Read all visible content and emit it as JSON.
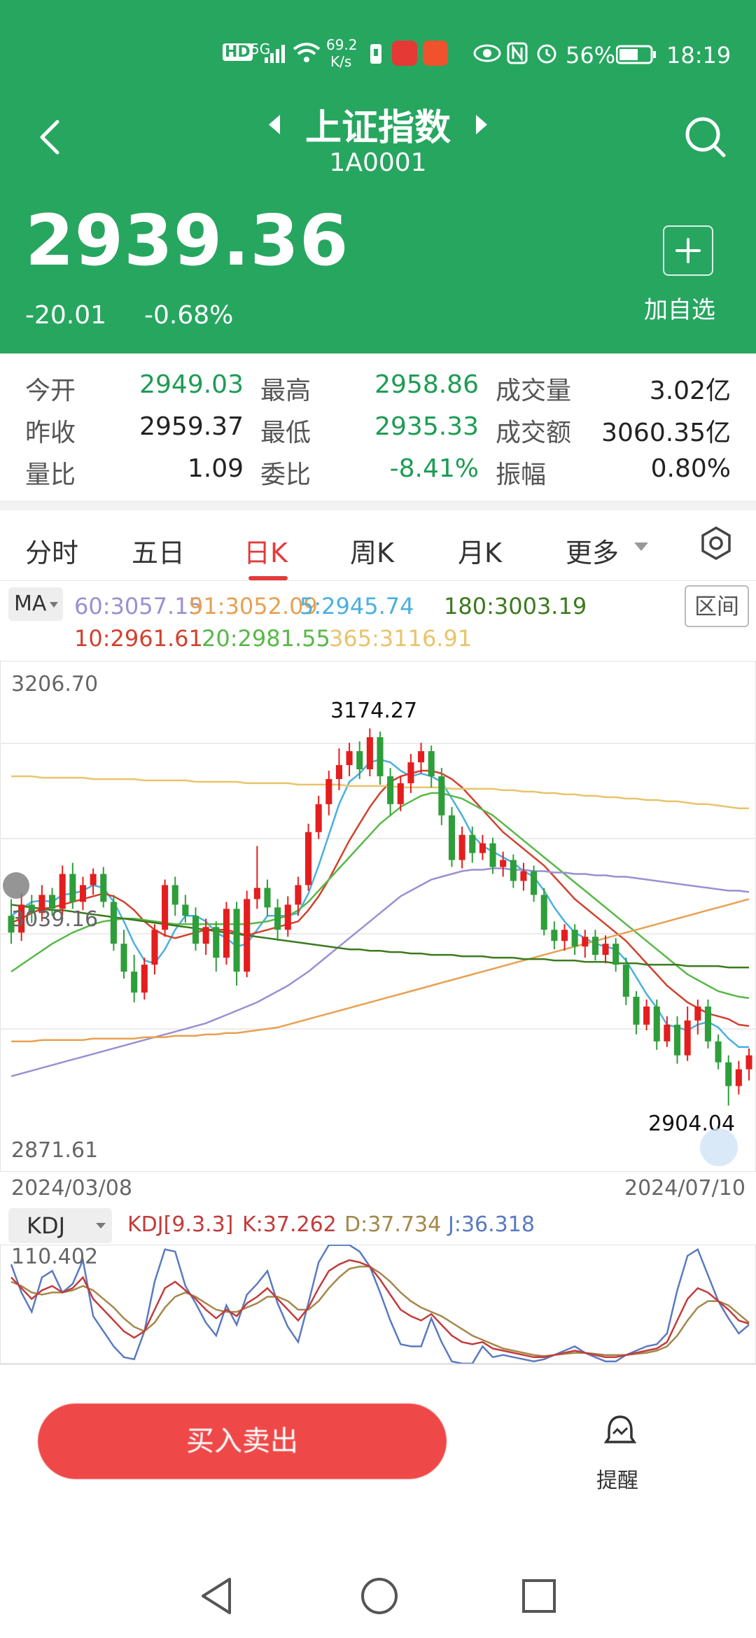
{
  "status_bar": {
    "hd": "HD",
    "signal": "5G",
    "speed_value": "69.2",
    "speed_unit": "K/s",
    "battery": "56%",
    "time": "18:19"
  },
  "header": {
    "title": "上证指数",
    "code": "1A0001",
    "price": "2939.36",
    "change": "-20.01",
    "change_pct": "-0.68%",
    "add_label": "加自选"
  },
  "stats": [
    {
      "label": "今开",
      "value": "2949.03",
      "color": "green"
    },
    {
      "label": "最高",
      "value": "2958.86",
      "color": "green"
    },
    {
      "label": "成交量",
      "value": "3.02亿",
      "color": "dark"
    },
    {
      "label": "昨收",
      "value": "2959.37",
      "color": "dark"
    },
    {
      "label": "最低",
      "value": "2935.33",
      "color": "green"
    },
    {
      "label": "成交额",
      "value": "3060.35亿",
      "color": "dark"
    },
    {
      "label": "量比",
      "value": "1.09",
      "color": "dark"
    },
    {
      "label": "委比",
      "value": "-8.41%",
      "color": "green"
    },
    {
      "label": "振幅",
      "value": "0.80%",
      "color": "dark"
    }
  ],
  "tabs": [
    {
      "label": "分时",
      "active": false
    },
    {
      "label": "五日",
      "active": false
    },
    {
      "label": "日K",
      "active": true
    },
    {
      "label": "周K",
      "active": false
    },
    {
      "label": "月K",
      "active": false
    },
    {
      "label": "更多",
      "active": false
    }
  ],
  "ma": {
    "button": "MA",
    "range_button": "区间",
    "items": [
      {
        "text": "60:3057.15",
        "color": "#9b8fd3"
      },
      {
        "text": "91:3052.09",
        "color": "#e8a050"
      },
      {
        "text": "5:2945.74",
        "color": "#4ab0e0"
      },
      {
        "text": "180:3003.19",
        "color": "#3c7a1e"
      },
      {
        "text": "10:2961.61",
        "color": "#d2412e"
      },
      {
        "text": "20:2981.55",
        "color": "#58b848"
      },
      {
        "text": "365:3116.91",
        "color": "#e8c46a"
      }
    ]
  },
  "chart": {
    "y_top": "3206.70",
    "y_mid": "3039.16",
    "y_bottom": "2871.61",
    "x_start": "2024/03/08",
    "x_end": "2024/07/10",
    "high_label": "3174.27",
    "low_label": "2904.04"
  },
  "kdj": {
    "button": "KDJ",
    "params": "KDJ[9.3.3]",
    "k": "K:37.262",
    "d": "D:37.734",
    "j": "J:36.318",
    "y_top": "110.402"
  },
  "bottom": {
    "big_button": "买入卖出",
    "remind": "提醒"
  },
  "chart_data": {
    "type": "candlestick",
    "title": "上证指数 日K",
    "x_range": [
      "2024/03/08",
      "2024/07/10"
    ],
    "ylim": [
      2871.61,
      3206.7
    ],
    "y_ticks": [
      2871.61,
      3039.16,
      3206.7
    ],
    "high": 3174.27,
    "low": 2904.04,
    "candles": [
      [
        3040,
        3028,
        3052,
        3020
      ],
      [
        3028,
        3048,
        3056,
        3022
      ],
      [
        3048,
        3042,
        3055,
        3035
      ],
      [
        3042,
        3055,
        3062,
        3036
      ],
      [
        3055,
        3045,
        3060,
        3040
      ],
      [
        3045,
        3070,
        3076,
        3040
      ],
      [
        3070,
        3050,
        3078,
        3045
      ],
      [
        3050,
        3062,
        3068,
        3044
      ],
      [
        3062,
        3070,
        3074,
        3055
      ],
      [
        3070,
        3050,
        3075,
        3046
      ],
      [
        3050,
        3020,
        3055,
        3015
      ],
      [
        3020,
        3000,
        3030,
        2995
      ],
      [
        3000,
        2985,
        3012,
        2978
      ],
      [
        2985,
        3005,
        3010,
        2980
      ],
      [
        3005,
        3030,
        3034,
        2998
      ],
      [
        3030,
        3062,
        3066,
        3025
      ],
      [
        3062,
        3048,
        3068,
        3040
      ],
      [
        3048,
        3040,
        3055,
        3035
      ],
      [
        3040,
        3020,
        3046,
        3015
      ],
      [
        3020,
        3032,
        3038,
        3012
      ],
      [
        3032,
        3010,
        3036,
        3000
      ],
      [
        3010,
        3045,
        3050,
        3005
      ],
      [
        3045,
        3000,
        3050,
        2990
      ],
      [
        3000,
        3052,
        3058,
        2996
      ],
      [
        3052,
        3060,
        3090,
        3045
      ],
      [
        3060,
        3046,
        3066,
        3040
      ],
      [
        3046,
        3030,
        3052,
        3022
      ],
      [
        3030,
        3048,
        3054,
        3025
      ],
      [
        3048,
        3062,
        3068,
        3040
      ],
      [
        3062,
        3100,
        3106,
        3058
      ],
      [
        3100,
        3120,
        3126,
        3095
      ],
      [
        3120,
        3138,
        3144,
        3112
      ],
      [
        3138,
        3148,
        3160,
        3130
      ],
      [
        3148,
        3158,
        3164,
        3140
      ],
      [
        3158,
        3145,
        3165,
        3138
      ],
      [
        3145,
        3168,
        3174.27,
        3140
      ],
      [
        3168,
        3140,
        3172,
        3134
      ],
      [
        3140,
        3120,
        3146,
        3112
      ],
      [
        3120,
        3135,
        3140,
        3115
      ],
      [
        3135,
        3150,
        3156,
        3128
      ],
      [
        3150,
        3158,
        3164,
        3142
      ],
      [
        3158,
        3140,
        3162,
        3132
      ],
      [
        3140,
        3112,
        3146,
        3105
      ],
      [
        3112,
        3080,
        3118,
        3075
      ],
      [
        3080,
        3098,
        3104,
        3074
      ],
      [
        3098,
        3085,
        3104,
        3078
      ],
      [
        3085,
        3092,
        3098,
        3080
      ],
      [
        3092,
        3075,
        3096,
        3070
      ],
      [
        3075,
        3080,
        3086,
        3068
      ],
      [
        3080,
        3065,
        3084,
        3060
      ],
      [
        3065,
        3072,
        3078,
        3058
      ],
      [
        3072,
        3055,
        3076,
        3050
      ],
      [
        3055,
        3030,
        3060,
        3026
      ],
      [
        3030,
        3022,
        3036,
        3016
      ],
      [
        3022,
        3030,
        3034,
        3015
      ],
      [
        3030,
        3018,
        3034,
        3012
      ],
      [
        3018,
        3025,
        3030,
        3010
      ],
      [
        3025,
        3012,
        3030,
        3008
      ],
      [
        3012,
        3020,
        3026,
        3006
      ],
      [
        3020,
        3005,
        3024,
        3000
      ],
      [
        3005,
        2982,
        3010,
        2976
      ],
      [
        2982,
        2962,
        2986,
        2955
      ],
      [
        2962,
        2975,
        2980,
        2958
      ],
      [
        2975,
        2950,
        2980,
        2944
      ],
      [
        2950,
        2962,
        2968,
        2946
      ],
      [
        2962,
        2940,
        2968,
        2934
      ],
      [
        2940,
        2965,
        2975,
        2936
      ],
      [
        2965,
        2975,
        2980,
        2955
      ],
      [
        2975,
        2950,
        2980,
        2945
      ],
      [
        2950,
        2935,
        2955,
        2930
      ],
      [
        2935,
        2918,
        2940,
        2904.04
      ],
      [
        2918,
        2930,
        2936,
        2912
      ],
      [
        2930,
        2940,
        2945,
        2922
      ]
    ],
    "series": [
      {
        "name": "MA5",
        "values": [
          3040,
          3045,
          3050,
          3051,
          3050,
          3055,
          3056,
          3058,
          3062,
          3060,
          3050,
          3036,
          3020,
          3008,
          3006,
          3016,
          3030,
          3040,
          3040,
          3036,
          3028,
          3024,
          3018,
          3020,
          3030,
          3040,
          3040,
          3040,
          3042,
          3056,
          3076,
          3098,
          3120,
          3136,
          3142,
          3150,
          3152,
          3150,
          3144,
          3140,
          3142,
          3140,
          3136,
          3124,
          3112,
          3098,
          3090,
          3086,
          3082,
          3078,
          3072,
          3068,
          3058,
          3046,
          3036,
          3028,
          3024,
          3020,
          3018,
          3016,
          3008,
          2996,
          2984,
          2974,
          2962,
          2960,
          2958,
          2962,
          2964,
          2960,
          2952,
          2946,
          2946
        ]
      },
      {
        "name": "MA10",
        "values": [
          3035,
          3038,
          3042,
          3045,
          3046,
          3048,
          3050,
          3052,
          3054,
          3056,
          3054,
          3050,
          3044,
          3036,
          3030,
          3026,
          3024,
          3026,
          3028,
          3030,
          3030,
          3030,
          3028,
          3026,
          3028,
          3030,
          3032,
          3034,
          3036,
          3044,
          3054,
          3066,
          3080,
          3094,
          3106,
          3118,
          3128,
          3136,
          3140,
          3142,
          3144,
          3144,
          3142,
          3138,
          3132,
          3124,
          3116,
          3108,
          3100,
          3094,
          3088,
          3082,
          3076,
          3068,
          3060,
          3052,
          3046,
          3040,
          3034,
          3028,
          3022,
          3014,
          3006,
          2998,
          2990,
          2984,
          2978,
          2974,
          2970,
          2968,
          2966,
          2962,
          2961
        ]
      },
      {
        "name": "MA20",
        "values": [
          3000,
          3005,
          3010,
          3015,
          3020,
          3024,
          3028,
          3031,
          3034,
          3036,
          3037,
          3038,
          3038,
          3037,
          3036,
          3035,
          3034,
          3034,
          3034,
          3034,
          3034,
          3034,
          3034,
          3034,
          3035,
          3036,
          3038,
          3040,
          3044,
          3050,
          3058,
          3066,
          3074,
          3082,
          3090,
          3098,
          3106,
          3112,
          3118,
          3122,
          3126,
          3128,
          3128,
          3126,
          3124,
          3120,
          3116,
          3112,
          3106,
          3100,
          3094,
          3088,
          3082,
          3076,
          3070,
          3064,
          3058,
          3052,
          3046,
          3040,
          3034,
          3028,
          3022,
          3016,
          3010,
          3004,
          2998,
          2994,
          2990,
          2986,
          2984,
          2982,
          2981
        ]
      },
      {
        "name": "MA60",
        "values": [
          2925,
          2927,
          2929,
          2931,
          2933,
          2935,
          2937,
          2939,
          2941,
          2943,
          2945,
          2947,
          2949,
          2951,
          2953,
          2955,
          2957,
          2959,
          2961,
          2963,
          2966,
          2969,
          2972,
          2975,
          2978,
          2982,
          2986,
          2990,
          2995,
          3000,
          3006,
          3012,
          3018,
          3024,
          3030,
          3036,
          3042,
          3048,
          3054,
          3058,
          3062,
          3066,
          3068,
          3070,
          3072,
          3073,
          3073,
          3074,
          3074,
          3073,
          3073,
          3072,
          3072,
          3071,
          3071,
          3070,
          3070,
          3069,
          3069,
          3068,
          3068,
          3067,
          3066,
          3065,
          3064,
          3063,
          3062,
          3061,
          3060,
          3059,
          3058,
          3058,
          3057
        ]
      },
      {
        "name": "MA91",
        "values": [
          2950,
          2950,
          2950,
          2951,
          2951,
          2951,
          2951,
          2951,
          2952,
          2952,
          2952,
          2952,
          2952,
          2953,
          2953,
          2953,
          2954,
          2954,
          2954,
          2955,
          2955,
          2956,
          2956,
          2957,
          2958,
          2959,
          2960,
          2962,
          2964,
          2966,
          2968,
          2970,
          2972,
          2974,
          2976,
          2978,
          2980,
          2982,
          2984,
          2986,
          2988,
          2990,
          2992,
          2994,
          2996,
          2998,
          3000,
          3002,
          3004,
          3006,
          3008,
          3010,
          3012,
          3014,
          3016,
          3018,
          3020,
          3022,
          3024,
          3026,
          3028,
          3030,
          3032,
          3034,
          3036,
          3038,
          3040,
          3042,
          3044,
          3046,
          3048,
          3050,
          3052
        ]
      },
      {
        "name": "MA180",
        "values": [
          3048,
          3047,
          3046,
          3045,
          3044,
          3044,
          3043,
          3042,
          3041,
          3040,
          3039,
          3038,
          3037,
          3036,
          3035,
          3034,
          3033,
          3032,
          3031,
          3030,
          3029,
          3028,
          3027,
          3026,
          3025,
          3024,
          3023,
          3022,
          3021,
          3020,
          3019,
          3018,
          3017,
          3016,
          3016,
          3015,
          3015,
          3014,
          3014,
          3013,
          3013,
          3012,
          3012,
          3012,
          3011,
          3011,
          3011,
          3010,
          3010,
          3010,
          3009,
          3009,
          3009,
          3008,
          3008,
          3008,
          3007,
          3007,
          3007,
          3006,
          3006,
          3006,
          3005,
          3005,
          3005,
          3005,
          3004,
          3004,
          3004,
          3004,
          3003,
          3003,
          3003
        ]
      },
      {
        "name": "MA365",
        "values": [
          3140,
          3140,
          3140,
          3139,
          3139,
          3139,
          3139,
          3139,
          3138,
          3138,
          3138,
          3138,
          3138,
          3137,
          3137,
          3137,
          3137,
          3137,
          3136,
          3136,
          3136,
          3136,
          3136,
          3135,
          3135,
          3135,
          3135,
          3135,
          3134,
          3134,
          3134,
          3134,
          3134,
          3133,
          3133,
          3133,
          3133,
          3133,
          3132,
          3132,
          3132,
          3132,
          3132,
          3131,
          3131,
          3131,
          3131,
          3131,
          3130,
          3130,
          3129,
          3129,
          3128,
          3128,
          3127,
          3127,
          3126,
          3126,
          3125,
          3125,
          3124,
          3124,
          3123,
          3123,
          3122,
          3122,
          3121,
          3120,
          3120,
          3119,
          3118,
          3117,
          3117
        ]
      }
    ],
    "kdj": {
      "ylim": [
        0,
        110.402
      ],
      "K": [
        80,
        70,
        60,
        68,
        72,
        66,
        70,
        80,
        60,
        50,
        40,
        30,
        24,
        30,
        50,
        70,
        76,
        68,
        60,
        50,
        42,
        50,
        44,
        56,
        62,
        70,
        60,
        50,
        40,
        52,
        70,
        86,
        92,
        96,
        94,
        90,
        78,
        64,
        50,
        44,
        40,
        46,
        36,
        26,
        20,
        18,
        20,
        14,
        12,
        10,
        8,
        6,
        6,
        8,
        10,
        12,
        10,
        8,
        6,
        6,
        8,
        10,
        12,
        14,
        20,
        40,
        60,
        70,
        66,
        58,
        50,
        40,
        37
      ],
      "D": [
        76,
        72,
        66,
        64,
        66,
        66,
        68,
        72,
        68,
        60,
        52,
        42,
        34,
        30,
        38,
        52,
        62,
        66,
        62,
        56,
        50,
        48,
        48,
        52,
        56,
        62,
        62,
        58,
        50,
        50,
        58,
        70,
        80,
        88,
        90,
        90,
        84,
        76,
        66,
        58,
        52,
        48,
        44,
        38,
        32,
        26,
        22,
        18,
        14,
        12,
        10,
        8,
        7,
        8,
        9,
        10,
        10,
        9,
        8,
        8,
        8,
        9,
        10,
        12,
        16,
        26,
        40,
        52,
        58,
        58,
        54,
        46,
        38
      ],
      "J": [
        92,
        66,
        48,
        80,
        86,
        66,
        74,
        96,
        44,
        30,
        16,
        6,
        4,
        30,
        76,
        106,
        104,
        72,
        56,
        38,
        26,
        54,
        36,
        64,
        74,
        86,
        56,
        34,
        20,
        56,
        94,
        110,
        110,
        110,
        104,
        90,
        66,
        40,
        18,
        16,
        16,
        42,
        20,
        2,
        0,
        0,
        16,
        6,
        8,
        6,
        4,
        2,
        4,
        8,
        12,
        16,
        10,
        6,
        2,
        2,
        8,
        12,
        16,
        18,
        28,
        68,
        100,
        106,
        82,
        58,
        42,
        28,
        36
      ]
    }
  }
}
